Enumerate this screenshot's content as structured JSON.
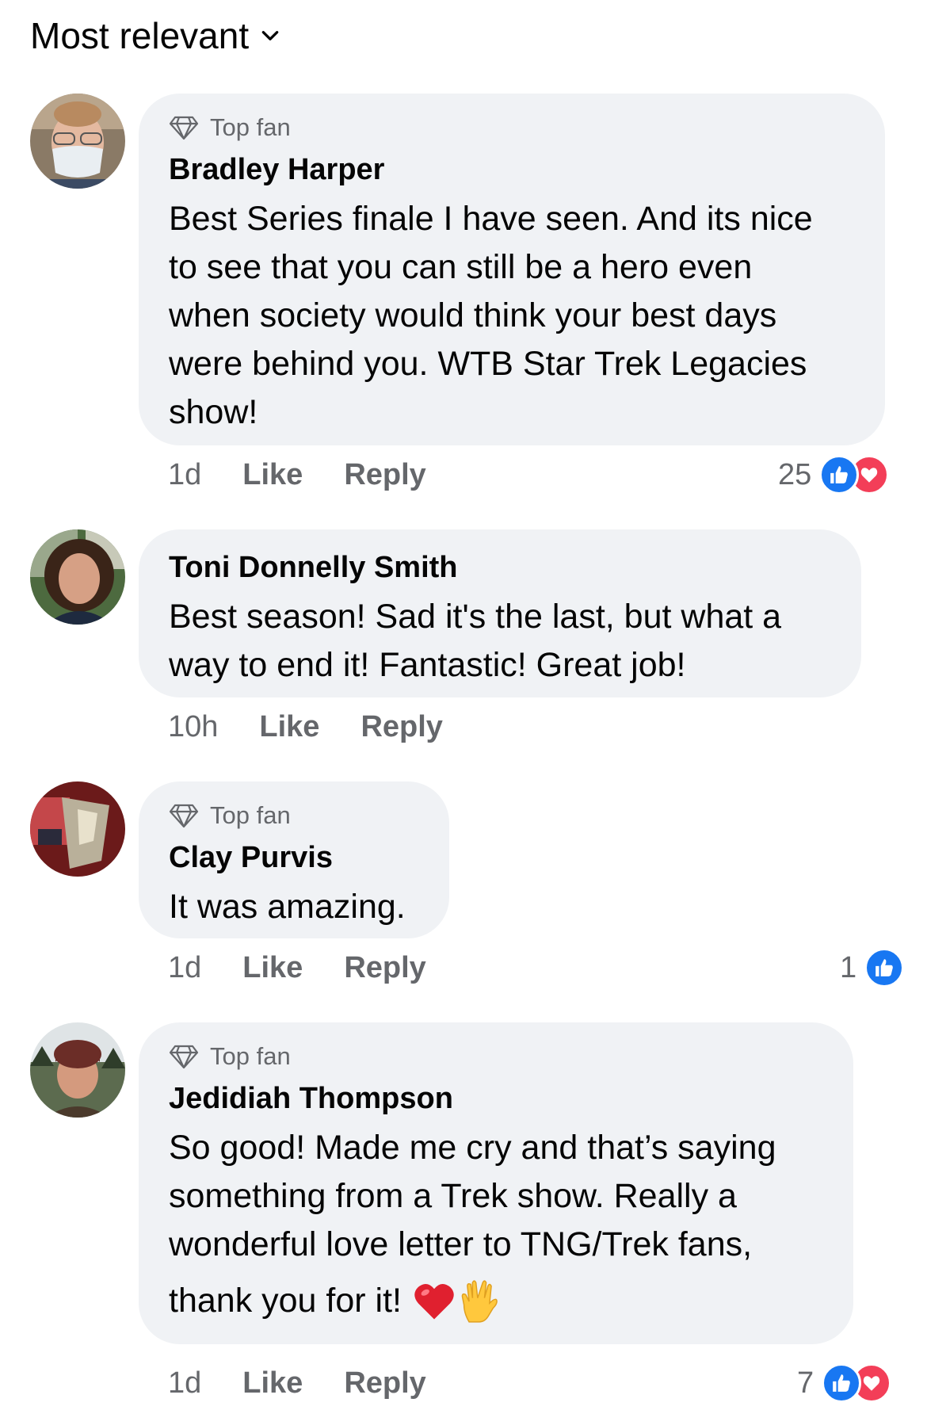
{
  "header": {
    "sort_label": "Most relevant"
  },
  "comments": [
    {
      "badge": "Top fan",
      "author": "Bradley Harper",
      "lines": [
        "Best Series finale I have seen. And its nice",
        "to see that you can still be a hero even",
        "when society would think your best days",
        "were behind you. WTB Star Trek Legacies",
        "show!"
      ],
      "time": "1d",
      "like_label": "Like",
      "reply_label": "Reply",
      "reaction_count": "25",
      "reactions": [
        "like",
        "love"
      ]
    },
    {
      "author": "Toni Donnelly Smith",
      "lines": [
        "Best season! Sad it's the last, but what a",
        "way to end it! Fantastic! Great job!"
      ],
      "time": "10h",
      "like_label": "Like",
      "reply_label": "Reply"
    },
    {
      "badge": "Top fan",
      "author": "Clay Purvis",
      "lines": [
        "It was amazing."
      ],
      "time": "1d",
      "like_label": "Like",
      "reply_label": "Reply",
      "reaction_count": "1",
      "reactions": [
        "like"
      ]
    },
    {
      "badge": "Top fan",
      "author": "Jedidiah Thompson",
      "lines": [
        "So good! Made me cry and that’s saying",
        "something from a Trek show. Really a",
        "wonderful love letter to TNG/Trek fans,",
        "thank you for it!"
      ],
      "emojis": [
        "red-heart",
        "vulcan-salute"
      ],
      "time": "1d",
      "like_label": "Like",
      "reply_label": "Reply",
      "reaction_count": "7",
      "reactions": [
        "like",
        "love"
      ]
    }
  ],
  "colors": {
    "bubble": "#f0f2f5",
    "meta": "#65676b",
    "like": "#1877f2",
    "love": "#f33e58"
  }
}
